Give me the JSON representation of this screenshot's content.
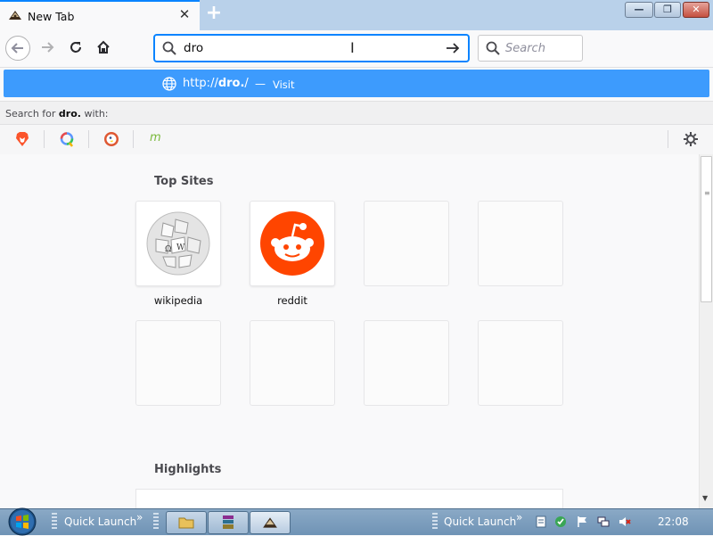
{
  "window": {
    "tab_title": "New Tab",
    "tab_close_glyph": "✕",
    "new_tab_glyph": "+",
    "controls": {
      "minimize": "—",
      "maximize": "❐",
      "close": "✕"
    }
  },
  "navbar": {
    "url_value": "dro",
    "cursor_glyph": "I",
    "search_placeholder": "Search"
  },
  "suggestion": {
    "url_prefix": "http://",
    "url_bold": "dro.",
    "url_suffix": "/",
    "dash": "—",
    "action": "Visit"
  },
  "search_for": {
    "prefix": "Search for ",
    "term": "dro.",
    "suffix": " with:"
  },
  "engines": [
    {
      "name": "brave",
      "icon": "brave-lion-icon",
      "color": "#fb542b"
    },
    {
      "name": "qwant",
      "icon": "qwant-icon",
      "color": "#5c97ff"
    },
    {
      "name": "duckduckgo",
      "icon": "duckduckgo-icon",
      "color": "#de5833"
    },
    {
      "name": "mojeek",
      "icon": "mojeek-icon",
      "glyph": "m",
      "color": "#7ab93c"
    }
  ],
  "top_sites": {
    "title": "Top Sites",
    "tiles": [
      {
        "label": "wikipedia",
        "icon": "wikipedia-globe-icon"
      },
      {
        "label": "reddit",
        "icon": "reddit-alien-icon",
        "color": "#ff4500"
      },
      {
        "label": ""
      },
      {
        "label": ""
      },
      {
        "label": ""
      },
      {
        "label": ""
      },
      {
        "label": ""
      },
      {
        "label": ""
      }
    ]
  },
  "highlights": {
    "title": "Highlights"
  },
  "taskbar": {
    "quick_launch_1": "Quick Launch",
    "quick_launch_2": "Quick Launch",
    "chevron": "»",
    "clock": "22:08"
  }
}
